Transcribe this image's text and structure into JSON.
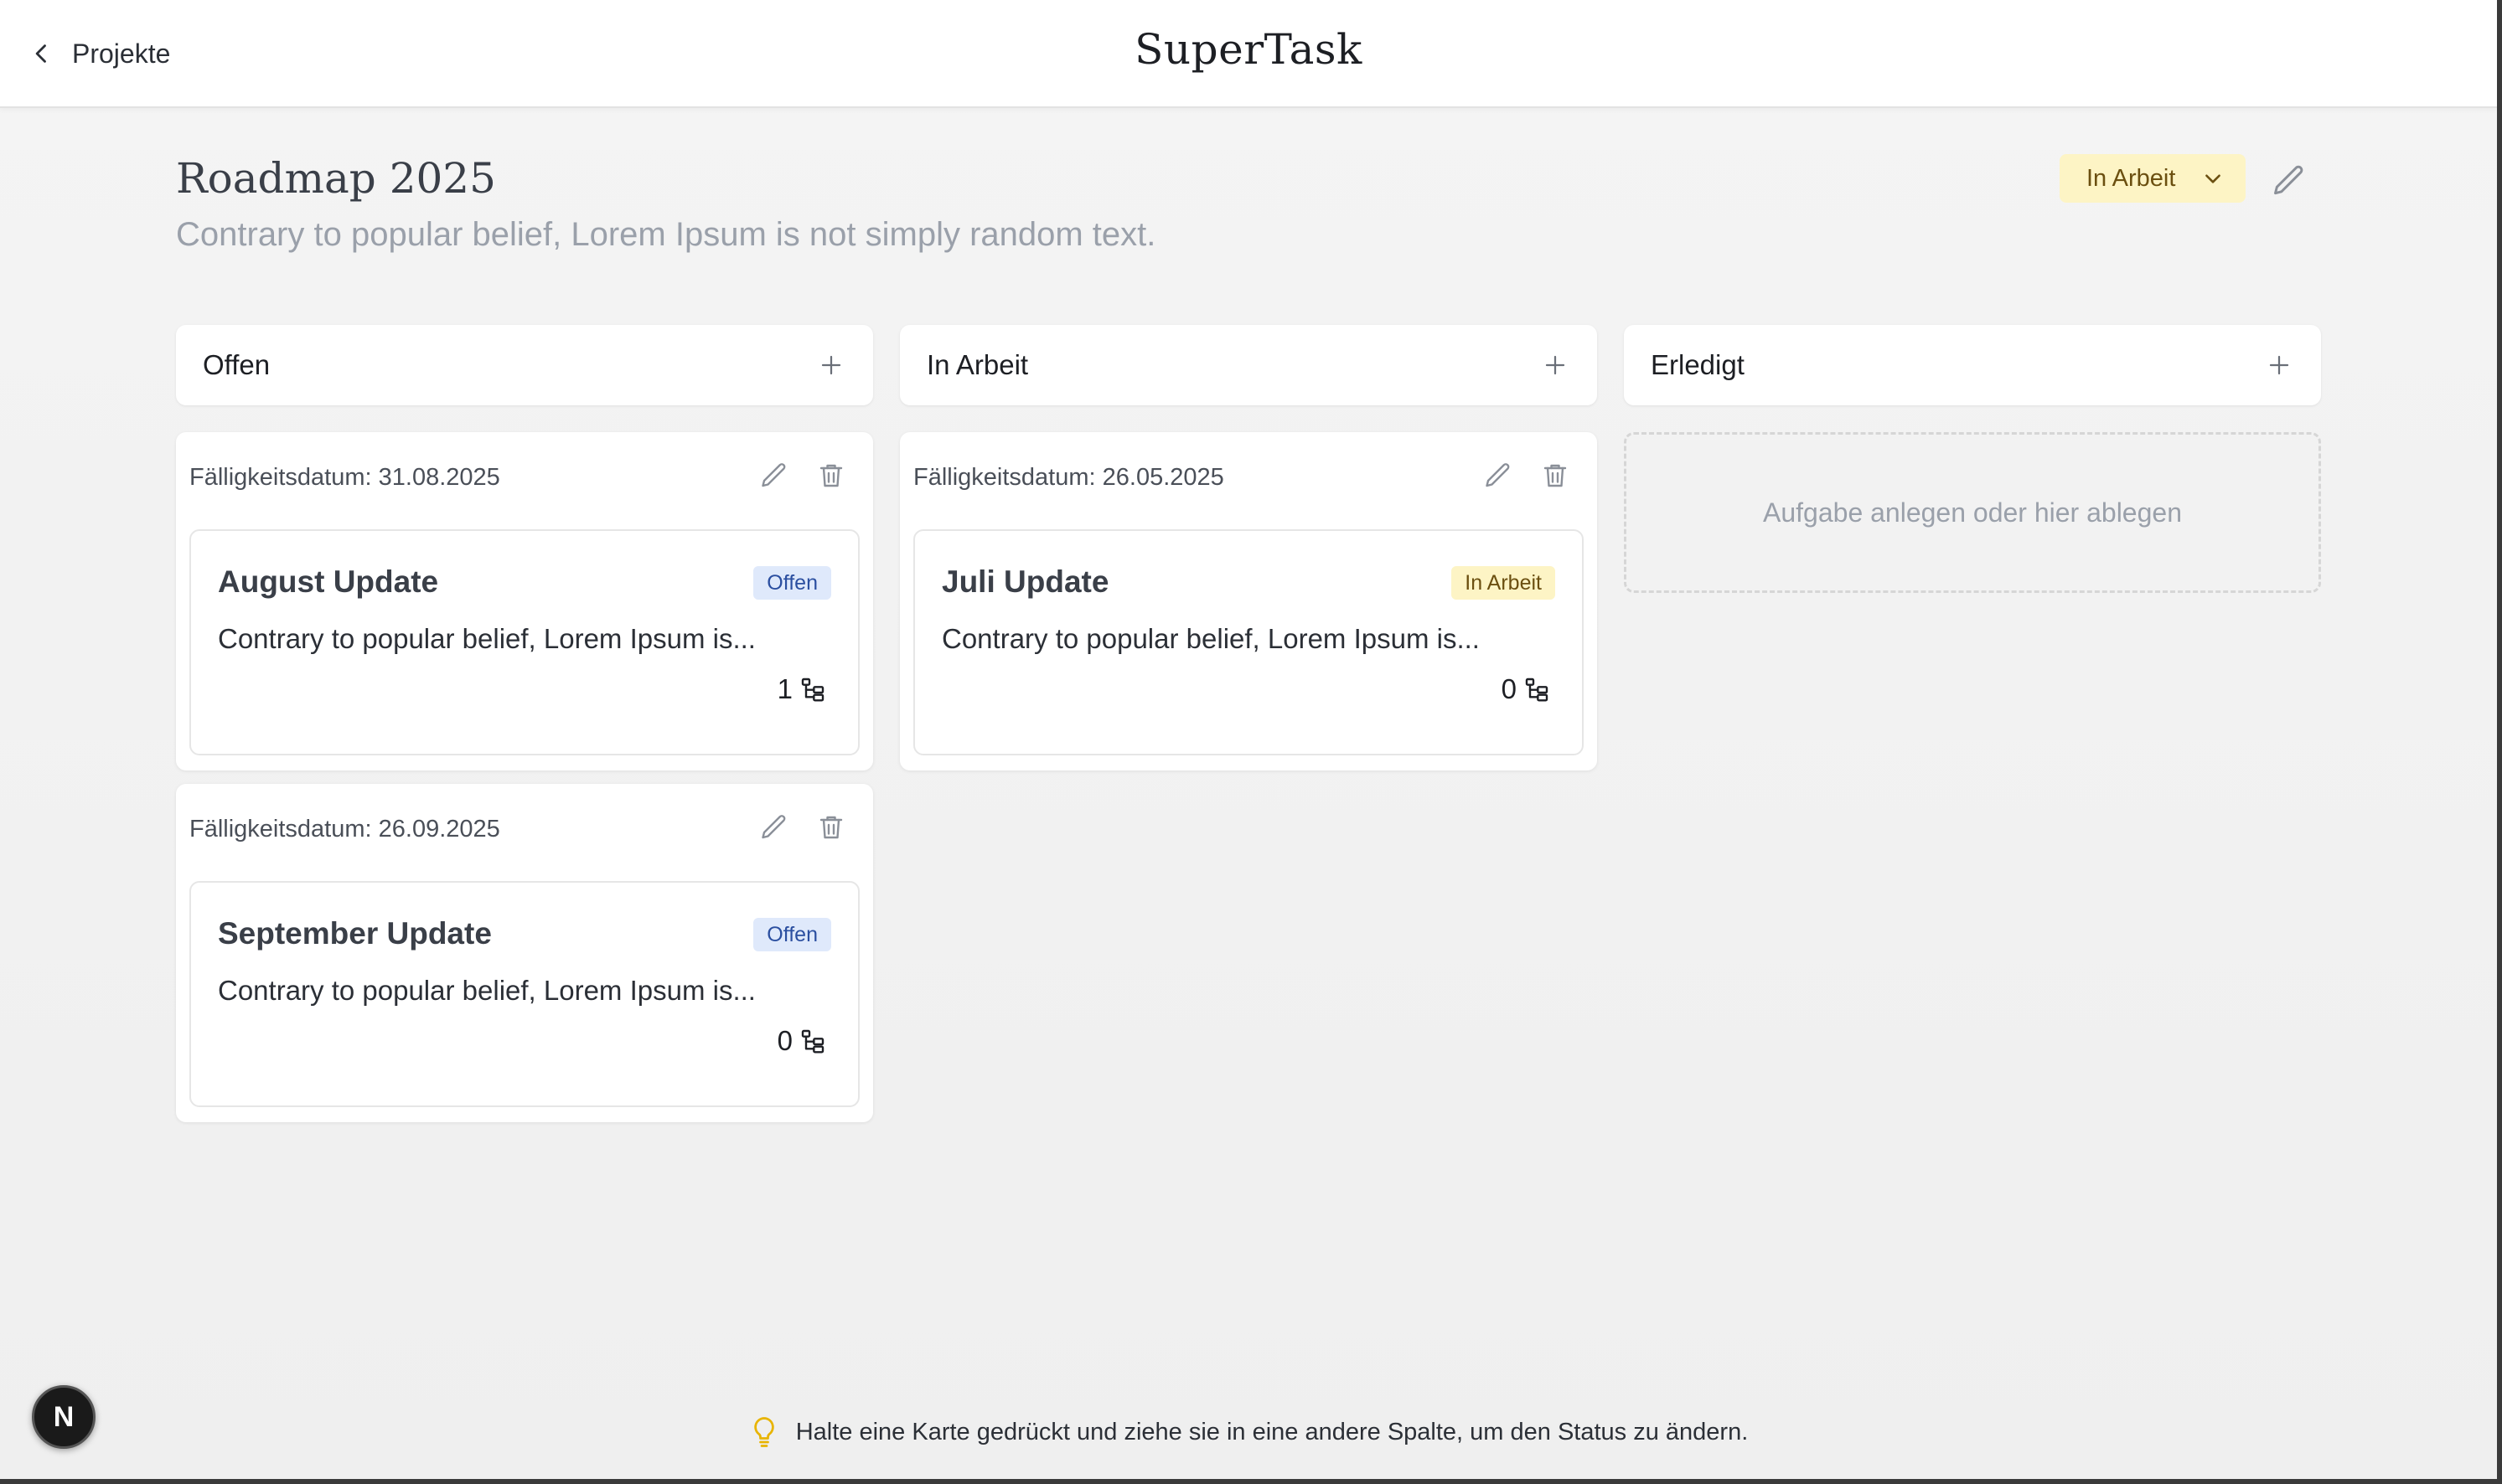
{
  "header": {
    "back_label": "Projekte",
    "app_title": "SuperTask"
  },
  "project": {
    "title": "Roadmap 2025",
    "description": "Contrary to popular belief, Lorem Ipsum is not simply random text.",
    "status": "In Arbeit"
  },
  "columns": [
    {
      "title": "Offen",
      "tasks": [
        {
          "due": "Fälligkeitsdatum: 31.08.2025",
          "title": "August Update",
          "badge": "Offen",
          "description": "Contrary to popular belief, Lorem Ipsum is...",
          "subtasks": "1"
        },
        {
          "due": "Fälligkeitsdatum: 26.09.2025",
          "title": "September Update",
          "badge": "Offen",
          "description": "Contrary to popular belief, Lorem Ipsum is...",
          "subtasks": "0"
        }
      ]
    },
    {
      "title": "In Arbeit",
      "tasks": [
        {
          "due": "Fälligkeitsdatum: 26.05.2025",
          "title": "Juli Update",
          "badge": "In Arbeit",
          "description": "Contrary to popular belief, Lorem Ipsum is...",
          "subtasks": "0"
        }
      ]
    },
    {
      "title": "Erledigt",
      "drop_hint": "Aufgabe anlegen oder hier ablegen"
    }
  ],
  "footer": {
    "hint": "Halte eine Karte gedrückt und ziehe sie in eine andere Spalte, um den Status zu ändern.",
    "badge_letter": "N"
  },
  "colors": {
    "badge_open_bg": "#dfe9fb",
    "badge_work_bg": "#fdf4c5",
    "hint_icon": "#e8b400"
  }
}
